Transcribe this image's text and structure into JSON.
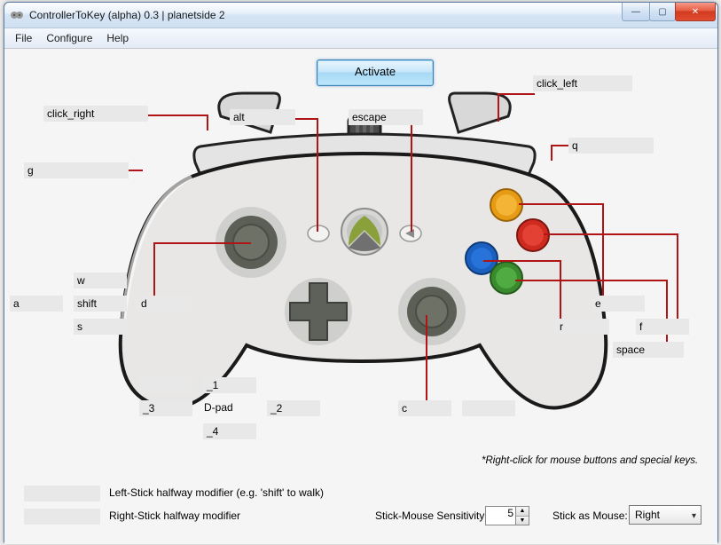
{
  "window": {
    "title": "ControllerToKey (alpha) 0.3 | planetside 2",
    "menu": {
      "file": "File",
      "configure": "Configure",
      "help": "Help"
    },
    "buttons": {
      "min": "—",
      "max": "▢",
      "close": "✕"
    }
  },
  "activate_label": "Activate",
  "mappings": {
    "lt": "click_right",
    "lb": "g",
    "back": "alt",
    "start": "escape",
    "rt": "click_left",
    "rb": "q",
    "ls_up": "w",
    "ls_down": "s",
    "ls_left": "a",
    "ls_right": "d",
    "ls_click": "shift",
    "dpad_up": "_1",
    "dpad_down": "_4",
    "dpad_left": "_3",
    "dpad_right": "_2",
    "dpad_up_extra": "",
    "rs_click": "c",
    "rs_extra": "",
    "btn_a": "space",
    "btn_b": "f",
    "btn_x": "r",
    "btn_y": "e",
    "ls_half": "",
    "rs_half": ""
  },
  "labels": {
    "dpad": "D-pad",
    "left_half": "Left-Stick halfway modifier (e.g. 'shift' to walk)",
    "right_half": "Right-Stick halfway modifier",
    "hint": "*Right-click for mouse buttons and special keys.",
    "sens": "Stick-Mouse Sensitivity:",
    "stick_as_mouse": "Stick as Mouse:"
  },
  "sensitivity": "5",
  "stick_as_mouse": "Right"
}
